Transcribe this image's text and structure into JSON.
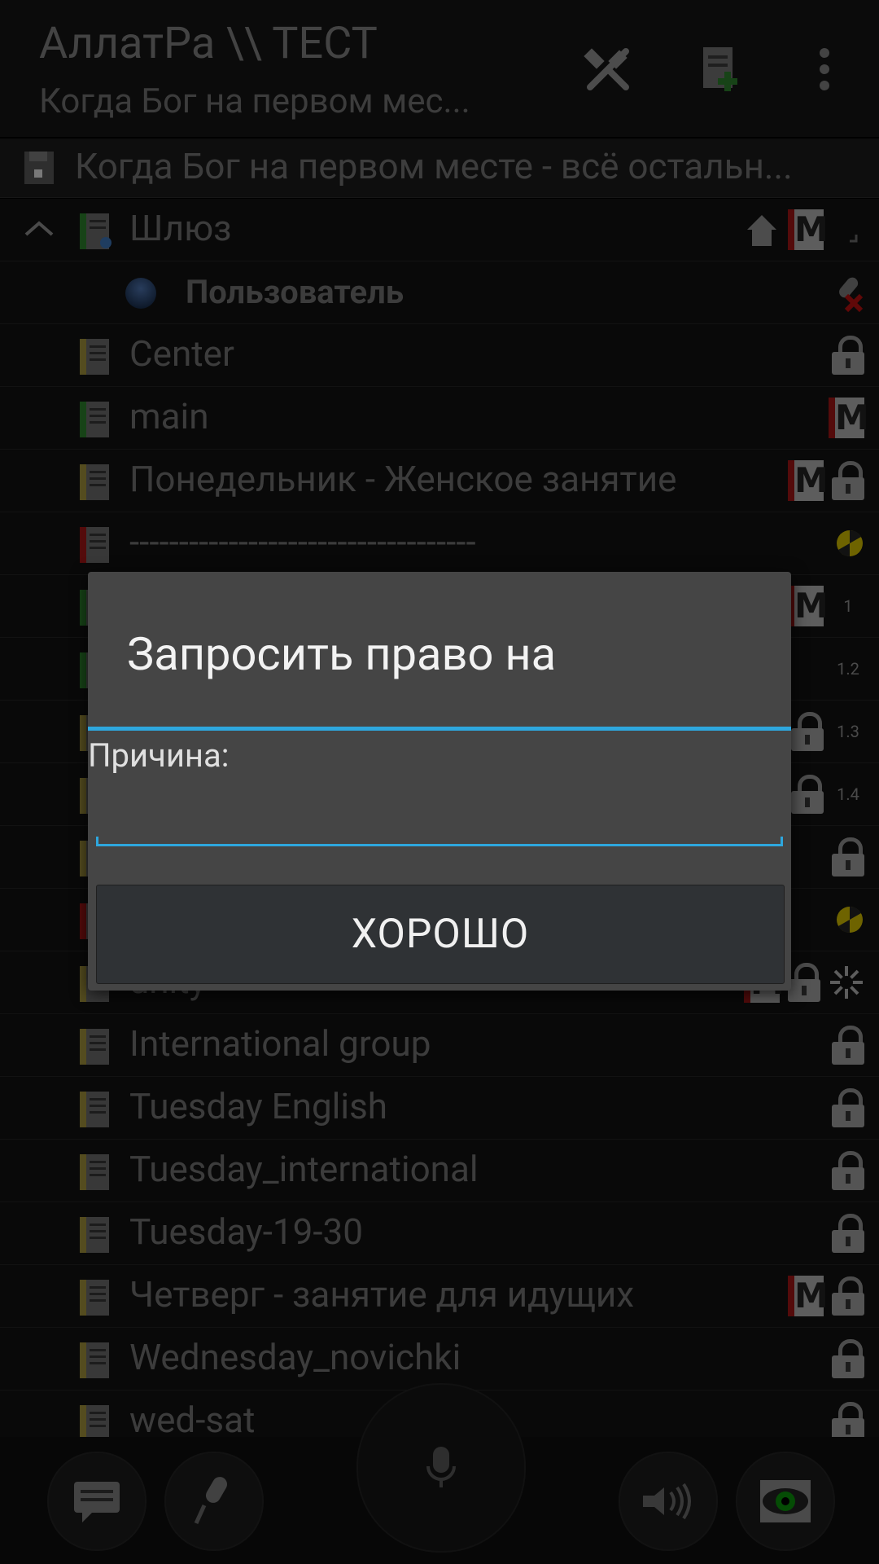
{
  "header": {
    "title": "АллатРа \\\\ ТЕСТ",
    "subtitle": "Когда Бог на первом мес...",
    "icons": [
      "tools-icon",
      "add-channel-icon",
      "overflow-menu-icon"
    ]
  },
  "channel_header": {
    "text": "Когда Бог на первом месте - всё остальн..."
  },
  "rows": [
    {
      "label": "Шлюз",
      "type": "gateway"
    },
    {
      "label": "Пользователь",
      "type": "user"
    },
    {
      "label": "Center",
      "type": "channel"
    },
    {
      "label": "main",
      "type": "channel"
    },
    {
      "label": "Понедельник - Женское занятие",
      "type": "channel"
    },
    {
      "label": "-----------------------------------",
      "type": "channel"
    },
    {
      "label": "",
      "type": "channel",
      "num": "1"
    },
    {
      "label": "",
      "type": "channel",
      "num": "1.2"
    },
    {
      "label": "",
      "type": "channel",
      "num": "1.3"
    },
    {
      "label": "",
      "type": "channel",
      "num": "1.4"
    },
    {
      "label": "",
      "type": "channel"
    },
    {
      "label": "",
      "type": "channel"
    },
    {
      "label": "unity",
      "type": "channel"
    },
    {
      "label": "International group",
      "type": "channel"
    },
    {
      "label": "Tuesday English",
      "type": "channel"
    },
    {
      "label": "Tuesday_international",
      "type": "channel"
    },
    {
      "label": "Tuesday-19-30",
      "type": "channel"
    },
    {
      "label": "Четверг - занятие для идущих",
      "type": "channel"
    },
    {
      "label": "Wednesday_novichki",
      "type": "channel"
    },
    {
      "label": "wed-sat",
      "type": "channel"
    }
  ],
  "dialog": {
    "title": "Запросить право на",
    "reason_label": "Причина:",
    "input_value": "",
    "ok_label": "ХОРОШО"
  },
  "bottom": {
    "buttons": [
      "chat-icon",
      "microphone-icon",
      "push-to-talk-icon",
      "volume-icon",
      "eye-icon"
    ]
  },
  "colors": {
    "accent": "#2ea7de",
    "background": "#000000",
    "dialog": "#454545",
    "mark": "#9a1515"
  }
}
